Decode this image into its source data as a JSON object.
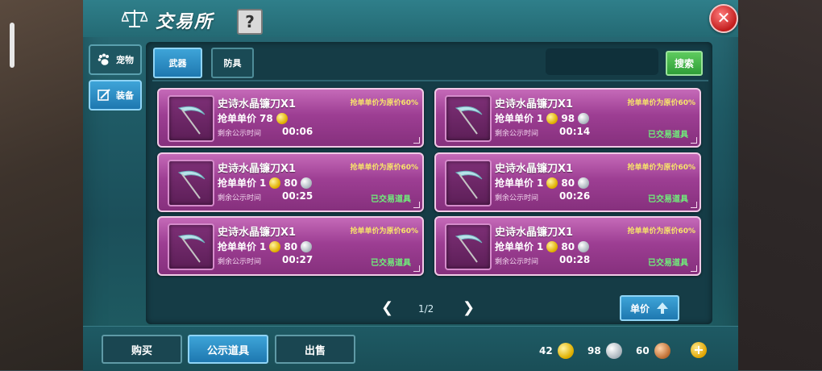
{
  "window": {
    "title": "交易所",
    "help_label": "?",
    "close_label": "✕"
  },
  "side_tabs": [
    {
      "label": "宠物",
      "icon": "paw-icon",
      "active": false
    },
    {
      "label": "装备",
      "icon": "equipment-icon",
      "active": true
    }
  ],
  "sub_tabs": [
    {
      "label": "武器",
      "active": true
    },
    {
      "label": "防具",
      "active": false
    }
  ],
  "search": {
    "button_label": "搜索",
    "value": ""
  },
  "listings": [
    {
      "name": "史诗水晶镰刀X1",
      "note": "抢单单价为原价60%",
      "price_label": "抢单单价",
      "gold": "78",
      "silver": "",
      "time_label": "剩余公示时间",
      "time": "00:06",
      "status": ""
    },
    {
      "name": "史诗水晶镰刀X1",
      "note": "抢单单价为原价60%",
      "price_label": "抢单单价",
      "gold": "1",
      "silver": "98",
      "time_label": "剩余公示时间",
      "time": "00:14",
      "status": "已交易道具"
    },
    {
      "name": "史诗水晶镰刀X1",
      "note": "抢单单价为原价60%",
      "price_label": "抢单单价",
      "gold": "1",
      "silver": "80",
      "time_label": "剩余公示时间",
      "time": "00:25",
      "status": "已交易道具"
    },
    {
      "name": "史诗水晶镰刀X1",
      "note": "抢单单价为原价60%",
      "price_label": "抢单单价",
      "gold": "1",
      "silver": "80",
      "time_label": "剩余公示时间",
      "time": "00:26",
      "status": "已交易道具"
    },
    {
      "name": "史诗水晶镰刀X1",
      "note": "抢单单价为原价60%",
      "price_label": "抢单单价",
      "gold": "1",
      "silver": "80",
      "time_label": "剩余公示时间",
      "time": "00:27",
      "status": "已交易道具"
    },
    {
      "name": "史诗水晶镰刀X1",
      "note": "抢单单价为原价60%",
      "price_label": "抢单单价",
      "gold": "1",
      "silver": "80",
      "time_label": "剩余公示时间",
      "time": "00:28",
      "status": "已交易道具"
    }
  ],
  "pager": {
    "page": "1/2",
    "prev": "❮",
    "next": "❯"
  },
  "sort_button": {
    "label": "单价"
  },
  "bottom_buttons": [
    {
      "label": "购买",
      "active": false
    },
    {
      "label": "公示道具",
      "active": true
    },
    {
      "label": "出售",
      "active": false
    }
  ],
  "currency": {
    "gold": "42",
    "silver": "98",
    "copper": "60",
    "add_label": "+"
  },
  "colors": {
    "card": "#9d3e93",
    "accent_blue": "#1e78b0",
    "traded_green": "#6ff07a",
    "note_yellow": "#f7e36a"
  }
}
